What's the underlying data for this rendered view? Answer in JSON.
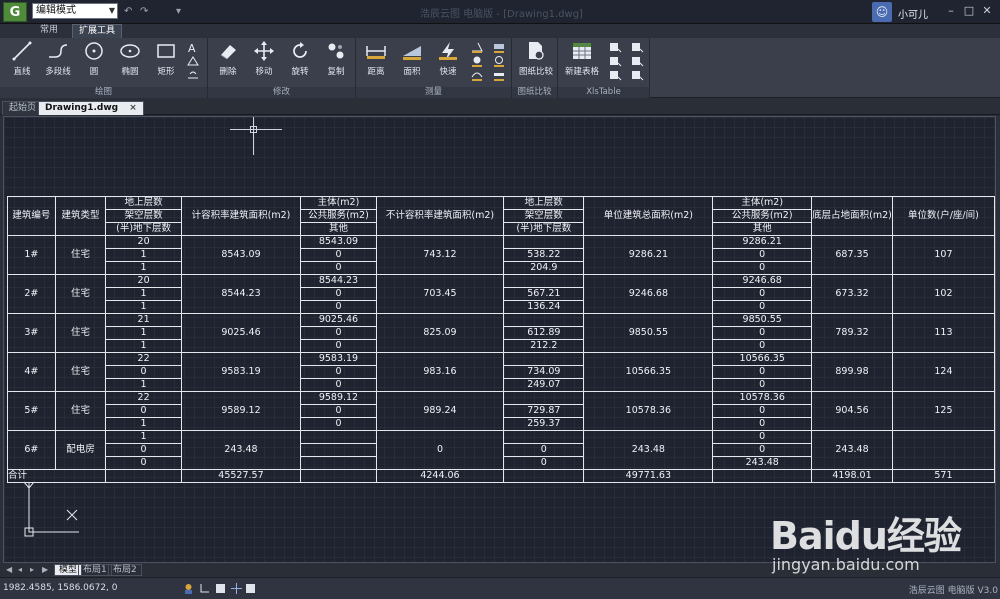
{
  "titlebar": {
    "mode": "编辑模式",
    "title": "浩辰云图 电脑版 - [Drawing1.dwg]",
    "user": "小可儿",
    "logo_letter": "G"
  },
  "ribbon_tabs": [
    "常用",
    "扩展工具"
  ],
  "ribbon_groups": {
    "draw": {
      "label": "绘图",
      "buttons": [
        "直线",
        "多段线",
        "圆",
        "椭圆",
        "矩形"
      ]
    },
    "modify": {
      "label": "修改",
      "buttons": [
        "删除",
        "移动",
        "旋转",
        "复制"
      ]
    },
    "measure": {
      "label": "测量",
      "buttons": [
        "距离",
        "面积",
        "快速"
      ]
    },
    "compare": {
      "label": "图纸比较",
      "buttons": [
        "图纸比较"
      ]
    },
    "xls": {
      "label": "XlsTable",
      "buttons": [
        "新建表格"
      ]
    }
  },
  "doc_tabs": [
    "起始页",
    "Drawing1.dwg"
  ],
  "table": {
    "headers": {
      "id": "建筑编号",
      "type": "建筑类型",
      "floor_top": "地上层数",
      "floor_mid": "架空层数",
      "floor_bot": "(半)地下层数",
      "a": "计容积率建筑面积(m2)",
      "b_top": "主体(m2)",
      "b_mid": "公共服务(m2)",
      "b_bot": "其他",
      "c": "不计容积率建筑面积(m2)",
      "d_top": "地上层数",
      "d_mid": "架空层数",
      "d_bot": "(半)地下层数",
      "e": "单位建筑总面积(m2)",
      "f_top": "主体(m2)",
      "f_mid": "公共服务(m2)",
      "f_bot": "其他",
      "g": "底层占地面积(m2)",
      "h": "单位数(户/座/间)"
    },
    "rows": [
      {
        "id": "1#",
        "type": "住宅",
        "floors": [
          "20",
          "1",
          "1"
        ],
        "a": "8543.09",
        "b": [
          "8543.09",
          "0",
          "0"
        ],
        "c": "743.12",
        "d": [
          "",
          "538.22",
          "204.9"
        ],
        "e": "9286.21",
        "f": [
          "9286.21",
          "0",
          "0"
        ],
        "g": "687.35",
        "h": "107"
      },
      {
        "id": "2#",
        "type": "住宅",
        "floors": [
          "20",
          "1",
          "1"
        ],
        "a": "8544.23",
        "b": [
          "8544.23",
          "0",
          "0"
        ],
        "c": "703.45",
        "d": [
          "",
          "567.21",
          "136.24"
        ],
        "e": "9246.68",
        "f": [
          "9246.68",
          "0",
          "0"
        ],
        "g": "673.32",
        "h": "102"
      },
      {
        "id": "3#",
        "type": "住宅",
        "floors": [
          "21",
          "1",
          "1"
        ],
        "a": "9025.46",
        "b": [
          "9025.46",
          "0",
          "0"
        ],
        "c": "825.09",
        "d": [
          "",
          "612.89",
          "212.2"
        ],
        "e": "9850.55",
        "f": [
          "9850.55",
          "0",
          "0"
        ],
        "g": "789.32",
        "h": "113"
      },
      {
        "id": "4#",
        "type": "住宅",
        "floors": [
          "22",
          "0",
          "1"
        ],
        "a": "9583.19",
        "b": [
          "9583.19",
          "0",
          "0"
        ],
        "c": "983.16",
        "d": [
          "",
          "734.09",
          "249.07"
        ],
        "e": "10566.35",
        "f": [
          "10566.35",
          "0",
          "0"
        ],
        "g": "899.98",
        "h": "124"
      },
      {
        "id": "5#",
        "type": "住宅",
        "floors": [
          "22",
          "0",
          "1"
        ],
        "a": "9589.12",
        "b": [
          "9589.12",
          "0",
          "0"
        ],
        "c": "989.24",
        "d": [
          "",
          "729.87",
          "259.37"
        ],
        "e": "10578.36",
        "f": [
          "10578.36",
          "0",
          "0"
        ],
        "g": "904.56",
        "h": "125"
      },
      {
        "id": "6#",
        "type": "配电房",
        "floors": [
          "1",
          "0",
          "0"
        ],
        "a": "243.48",
        "b": [
          "",
          "",
          ""
        ],
        "c": "0",
        "d": [
          "",
          "0",
          "0"
        ],
        "e": "243.48",
        "f": [
          "0",
          "0",
          "243.48"
        ],
        "g": "243.48",
        "h": ""
      }
    ],
    "total": {
      "label": "合计",
      "a": "45527.57",
      "c": "4244.06",
      "e": "49771.63",
      "g": "4198.01",
      "h": "571"
    }
  },
  "layout_tabs": [
    "模型",
    "布局1",
    "布局2"
  ],
  "status": {
    "coords": "1982.4585, 1586.0672, 0",
    "version": "浩辰云图 电脑版 V3.0"
  },
  "watermark": {
    "main": "Baidu经验",
    "sub": "jingyan.baidu.com"
  }
}
